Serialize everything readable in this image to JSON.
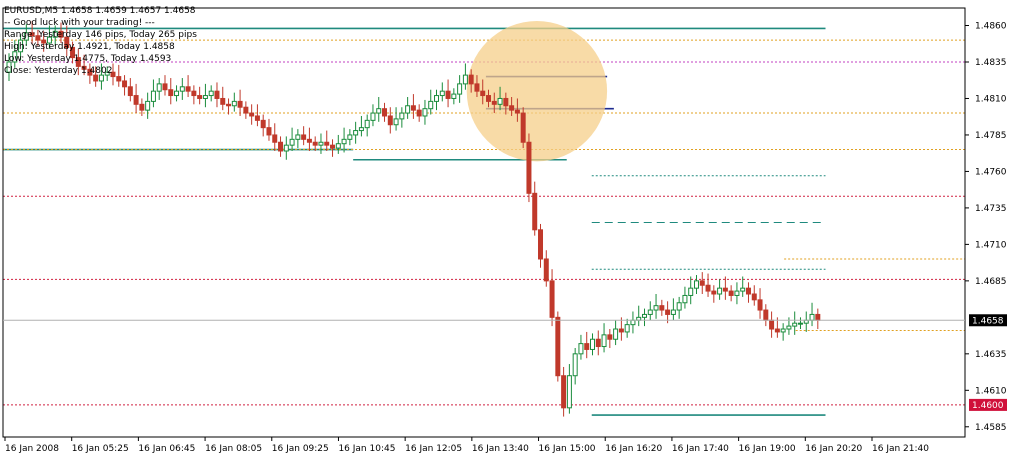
{
  "window": {
    "symbol_header": "EURUSD,M5  1.4658 1.4659 1.4657 1.4658"
  },
  "info_lines": [
    "-- Good luck with your trading! ---",
    "Range: Yesterday 146 pips, Today 265 pips",
    "High: Yesterday 1.4921, Today 1.4858",
    "Low: Yesterday 1.4775, Today 1.4593",
    "Close: Yesterday 1.4802"
  ],
  "colors": {
    "axis": "#000000",
    "up_candle": "#1a8c3c",
    "down_candle": "#c0392b",
    "teal_level": "#1f8a7e",
    "navy_level": "#1d2b8f",
    "orange_level": "#e0a020",
    "red_level": "#d02040",
    "magenta_level": "#c040c0",
    "highlight": "#f6cf8a",
    "current_price_bg": "#000000",
    "alert_price_bg": "#d0103a"
  },
  "current_price_label": "1.4658",
  "alert_price_label": "1.4600",
  "chart_data": {
    "type": "candlestick",
    "symbol": "EURUSD",
    "timeframe": "M5",
    "ylim": [
      1.4578,
      1.4872
    ],
    "y_ticks": [
      "1.4860",
      "1.4835",
      "1.4810",
      "1.4785",
      "1.4760",
      "1.4735",
      "1.4710",
      "1.4685",
      "1.4635",
      "1.4610",
      "1.4585"
    ],
    "x_ticks": [
      "16 Jan 2008",
      "16 Jan 05:25",
      "16 Jan 06:45",
      "16 Jan 08:05",
      "16 Jan 09:25",
      "16 Jan 10:45",
      "16 Jan 12:05",
      "16 Jan 13:40",
      "16 Jan 15:00",
      "16 Jan 16:20",
      "16 Jan 17:40",
      "16 Jan 19:00",
      "16 Jan 20:20",
      "16 Jan 21:40"
    ],
    "levels": [
      {
        "price": 1.4858,
        "style": "solid",
        "color": "teal_level",
        "from": 0.0,
        "to": 0.855
      },
      {
        "price": 1.485,
        "style": "dotted",
        "color": "orange_level",
        "from": 0.0,
        "to": 1.0
      },
      {
        "price": 1.4835,
        "style": "dotted",
        "color": "magenta_level",
        "from": 0.0,
        "to": 1.0
      },
      {
        "price": 1.4825,
        "style": "solid",
        "color": "navy_level",
        "from": 0.502,
        "to": 0.628
      },
      {
        "price": 1.4803,
        "style": "solid",
        "color": "navy_level",
        "from": 0.502,
        "to": 0.635
      },
      {
        "price": 1.48,
        "style": "dotted",
        "color": "orange_level",
        "from": 0.0,
        "to": 1.0
      },
      {
        "price": 1.4775,
        "style": "solid",
        "color": "teal_level",
        "from": 0.0,
        "to": 0.364
      },
      {
        "price": 1.4775,
        "style": "dotted",
        "color": "orange_level",
        "from": 0.0,
        "to": 1.0
      },
      {
        "price": 1.4768,
        "style": "solid",
        "color": "teal_level",
        "from": 0.364,
        "to": 0.586
      },
      {
        "price": 1.4743,
        "style": "dotted",
        "color": "red_level",
        "from": 0.0,
        "to": 1.0
      },
      {
        "price": 1.4757,
        "style": "dotted",
        "color": "teal_level",
        "from": 0.612,
        "to": 0.855
      },
      {
        "price": 1.4725,
        "style": "dashed",
        "color": "teal_level",
        "from": 0.612,
        "to": 0.855
      },
      {
        "price": 1.47,
        "style": "dotted",
        "color": "orange_level",
        "from": 0.812,
        "to": 1.0
      },
      {
        "price": 1.4693,
        "style": "dotted",
        "color": "teal_level",
        "from": 0.612,
        "to": 0.855
      },
      {
        "price": 1.4686,
        "style": "dotted",
        "color": "red_level",
        "from": 0.0,
        "to": 1.0
      },
      {
        "price": 1.4651,
        "style": "dotted",
        "color": "orange_level",
        "from": 0.824,
        "to": 1.0
      },
      {
        "price": 1.46,
        "style": "dotted",
        "color": "red_level",
        "from": 0.0,
        "to": 1.0
      },
      {
        "price": 1.4593,
        "style": "solid",
        "color": "teal_level",
        "from": 0.612,
        "to": 0.855
      }
    ],
    "highlight_circle": {
      "center_time_fraction": 0.555,
      "center_price": 1.4815,
      "radius_pips": 26
    },
    "price_path": [
      1.4828,
      1.4835,
      1.4842,
      1.485,
      1.4855,
      1.4853,
      1.485,
      1.4848,
      1.4852,
      1.4856,
      1.4852,
      1.4845,
      1.4838,
      1.4832,
      1.483,
      1.4826,
      1.4822,
      1.4826,
      1.4828,
      1.4825,
      1.4822,
      1.4818,
      1.4812,
      1.4806,
      1.4802,
      1.4808,
      1.4815,
      1.482,
      1.4816,
      1.4812,
      1.4815,
      1.4818,
      1.4815,
      1.4812,
      1.481,
      1.4812,
      1.4815,
      1.481,
      1.4806,
      1.4805,
      1.4808,
      1.4804,
      1.48,
      1.4798,
      1.4795,
      1.479,
      1.4785,
      1.478,
      1.4774,
      1.4778,
      1.4782,
      1.4785,
      1.4782,
      1.478,
      1.4778,
      1.478,
      1.4778,
      1.4776,
      1.4779,
      1.4782,
      1.4785,
      1.4788,
      1.479,
      1.4795,
      1.48,
      1.4803,
      1.4798,
      1.4792,
      1.4796,
      1.48,
      1.4805,
      1.4802,
      1.4798,
      1.4803,
      1.4808,
      1.4812,
      1.4815,
      1.481,
      1.4813,
      1.482,
      1.4826,
      1.482,
      1.4815,
      1.4812,
      1.4808,
      1.4806,
      1.481,
      1.4805,
      1.4802,
      1.48,
      1.478,
      1.4745,
      1.472,
      1.47,
      1.4685,
      1.466,
      1.462,
      1.4598,
      1.462,
      1.4635,
      1.4642,
      1.4638,
      1.4645,
      1.464,
      1.4648,
      1.4645,
      1.4652,
      1.465,
      1.4655,
      1.4658,
      1.466,
      1.4662,
      1.4665,
      1.4668,
      1.4665,
      1.4662,
      1.4665,
      1.467,
      1.4675,
      1.468,
      1.4685,
      1.4682,
      1.4678,
      1.4676,
      1.468,
      1.4678,
      1.4675,
      1.4678,
      1.468,
      1.4676,
      1.4672,
      1.4665,
      1.4658,
      1.4652,
      1.465,
      1.4652,
      1.4654,
      1.4656,
      1.4656,
      1.4658,
      1.4662,
      1.4658
    ]
  }
}
